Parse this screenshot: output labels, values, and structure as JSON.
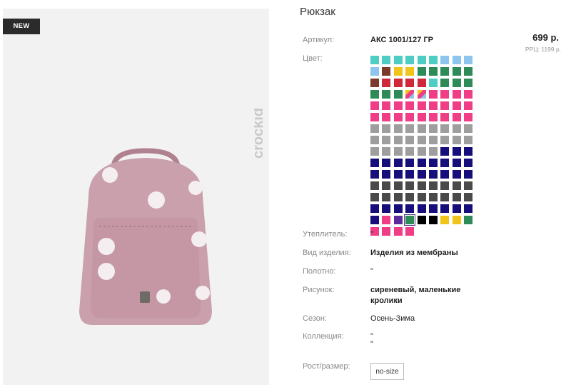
{
  "product": {
    "badge": "NEW",
    "brand": "crockid",
    "title": "Рюкзак",
    "price": "699 р.",
    "rrp": "РРЦ: 1199 р.",
    "size_button": "no-size"
  },
  "attributes": {
    "article_label": "Артикул:",
    "article_value": "АКС 1001/127 ГР",
    "color_label": "Цвет:",
    "insulation_label": "Утеплитель:",
    "insulation_value": "\"",
    "type_label": "Вид изделия:",
    "type_value": "Изделия из мембраны",
    "fabric_label": "Полотно:",
    "fabric_value": "\"",
    "pattern_label": "Рисунок:",
    "pattern_value_1": "сиреневый, маленькие",
    "pattern_value_2": "кролики",
    "season_label": "Сезон:",
    "season_value": "Осень-Зима",
    "collection_label": "Коллекция:",
    "collection_value_1": "\"",
    "collection_value_2": "\"",
    "size_label": "Рост/размер:"
  },
  "colors": {
    "turquoise": "#4ecdc4",
    "lightblue": "#8ec5ee",
    "brown": "#7b3a2c",
    "yellow": "#f0c419",
    "green": "#2e8b57",
    "red": "#d0273a",
    "pink": "#ef3d86",
    "gray": "#9e9e9e",
    "navy": "#160e7a",
    "darkgray": "#4a4a4a",
    "black": "#000000",
    "purple": "#5b2a9b"
  },
  "swatches": [
    "turquoise",
    "turquoise",
    "turquoise",
    "turquoise",
    "turquoise",
    "turquoise",
    "lightblue",
    "lightblue",
    "lightblue",
    "lightblue",
    "brown",
    "yellow",
    "yellow",
    "green",
    "green",
    "green",
    "green",
    "green",
    "brown",
    "red",
    "red",
    "red",
    "red",
    "turquoise",
    "green",
    "green",
    "green",
    "green",
    "green",
    "green",
    "multi",
    "multi",
    "pink",
    "pink",
    "pink",
    "pink",
    "pink",
    "pink",
    "pink",
    "pink",
    "pink",
    "pink",
    "pink",
    "pink",
    "pink",
    "pink",
    "pink",
    "pink",
    "pink",
    "pink",
    "pink",
    "pink",
    "pink",
    "pink",
    "gray",
    "gray",
    "gray",
    "gray",
    "gray",
    "gray",
    "gray",
    "gray",
    "gray",
    "gray",
    "gray",
    "gray",
    "gray",
    "gray",
    "gray",
    "gray",
    "gray",
    "gray",
    "gray",
    "gray",
    "gray",
    "gray",
    "gray",
    "gray",
    "navy",
    "navy",
    "navy",
    "navy",
    "navy",
    "navy",
    "navy",
    "navy",
    "navy",
    "navy",
    "navy",
    "navy",
    "navy",
    "navy",
    "navy",
    "navy",
    "navy",
    "navy",
    "navy",
    "navy",
    "navy",
    "darkgray",
    "darkgray",
    "darkgray",
    "darkgray",
    "darkgray",
    "darkgray",
    "darkgray",
    "darkgray",
    "darkgray",
    "darkgray",
    "darkgray",
    "darkgray",
    "darkgray",
    "darkgray",
    "darkgray",
    "darkgray",
    "darkgray",
    "darkgray",
    "navy",
    "navy",
    "navy",
    "navy",
    "navy",
    "navy",
    "navy",
    "navy",
    "navy",
    "navy",
    "pink",
    "purple",
    "green",
    "black",
    "black",
    "yellow",
    "yellow",
    "green",
    "pink",
    "pink",
    "pink",
    "pink"
  ],
  "selected_swatch": 129
}
